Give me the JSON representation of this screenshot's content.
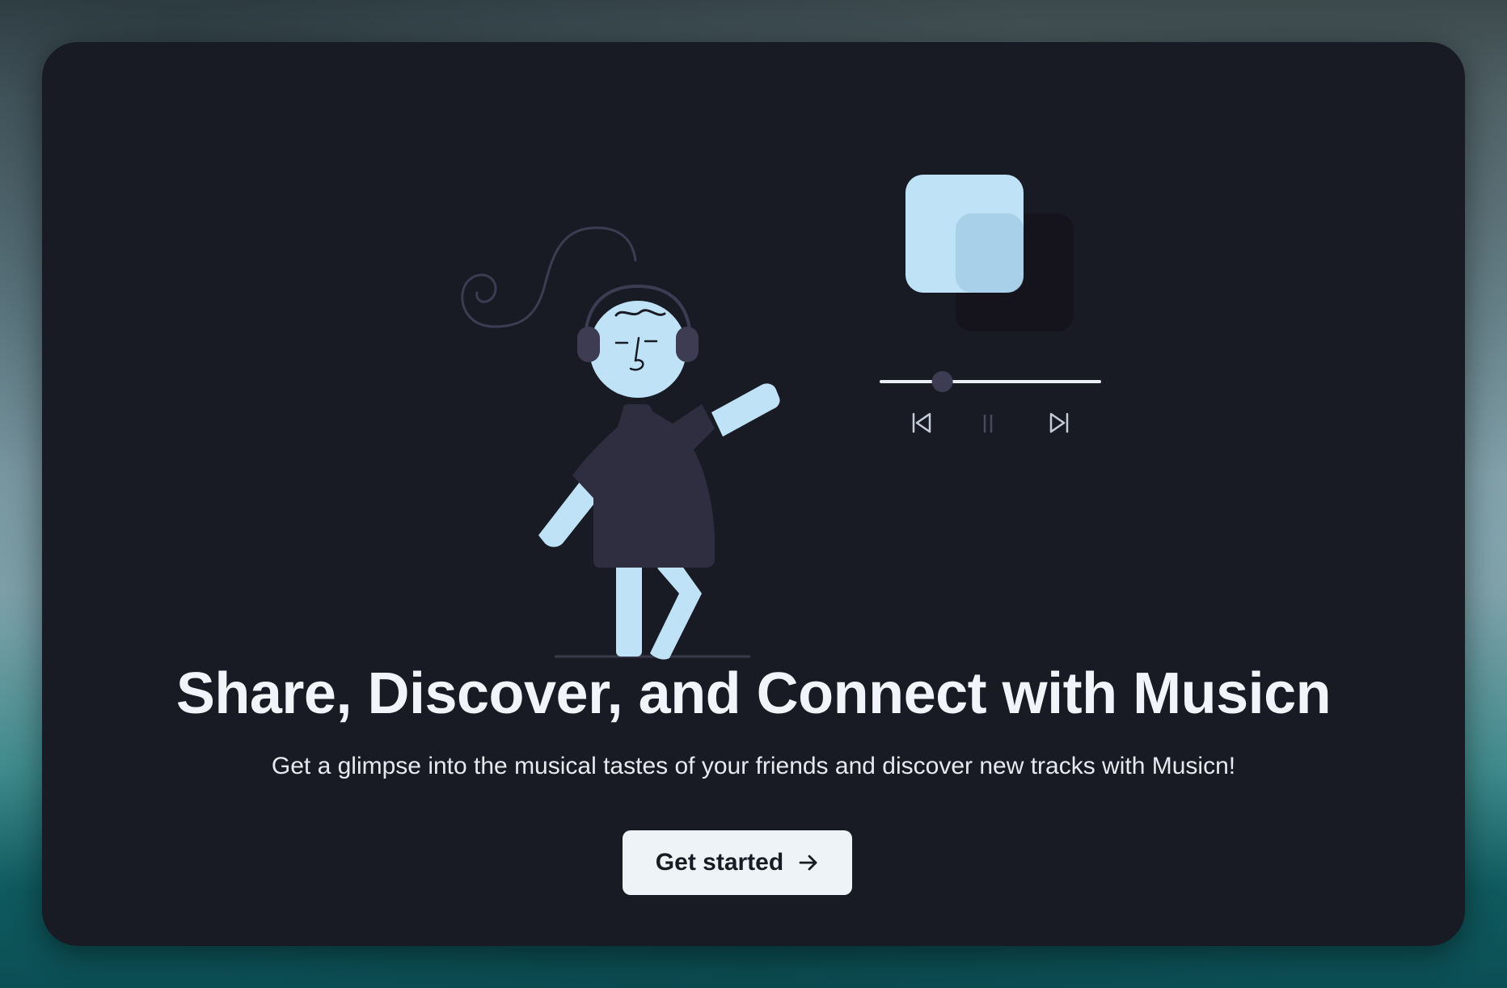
{
  "hero": {
    "headline": "Share, Discover, and Connect with Musicn",
    "subtitle": "Get a glimpse into the musical tastes of your friends and discover new tracks with Musicn!",
    "cta_label": "Get started",
    "cta_icon": "arrow-right-icon"
  },
  "player": {
    "progress": 0.28,
    "controls": [
      "skip-back-icon",
      "pause-icon",
      "skip-forward-icon"
    ]
  },
  "colors": {
    "card_background": "#191b24",
    "accent_light_blue": "#bfe2f7",
    "figure_dark": "#2f2d40",
    "headline_text": "#f1f4f8",
    "button_background": "#eef3f8"
  }
}
